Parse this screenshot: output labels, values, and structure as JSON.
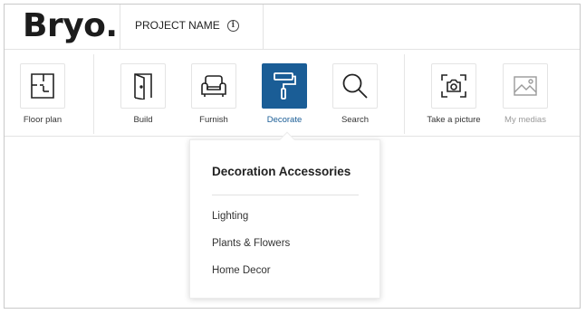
{
  "app": {
    "logo": "Bryo."
  },
  "header": {
    "project_name": "PROJECT NAME",
    "info_icon": "info-icon"
  },
  "toolbar": {
    "tools": [
      {
        "label": "Floor plan",
        "icon": "floor-plan-icon",
        "state": "normal"
      },
      {
        "label": "Build",
        "icon": "door-icon",
        "state": "normal"
      },
      {
        "label": "Furnish",
        "icon": "armchair-icon",
        "state": "normal"
      },
      {
        "label": "Decorate",
        "icon": "paint-roller-icon",
        "state": "active"
      },
      {
        "label": "Search",
        "icon": "search-icon",
        "state": "normal"
      },
      {
        "label": "Take a picture",
        "icon": "camera-icon",
        "state": "normal"
      },
      {
        "label": "My medias",
        "icon": "image-icon",
        "state": "disabled"
      }
    ]
  },
  "dropdown": {
    "title": "Decoration Accessories",
    "items": [
      "Lighting",
      "Plants & Flowers",
      "Home Decor"
    ]
  },
  "colors": {
    "accent": "#1a5d96",
    "border": "#c9c9c9",
    "disabled_text": "#9a9a9a"
  }
}
